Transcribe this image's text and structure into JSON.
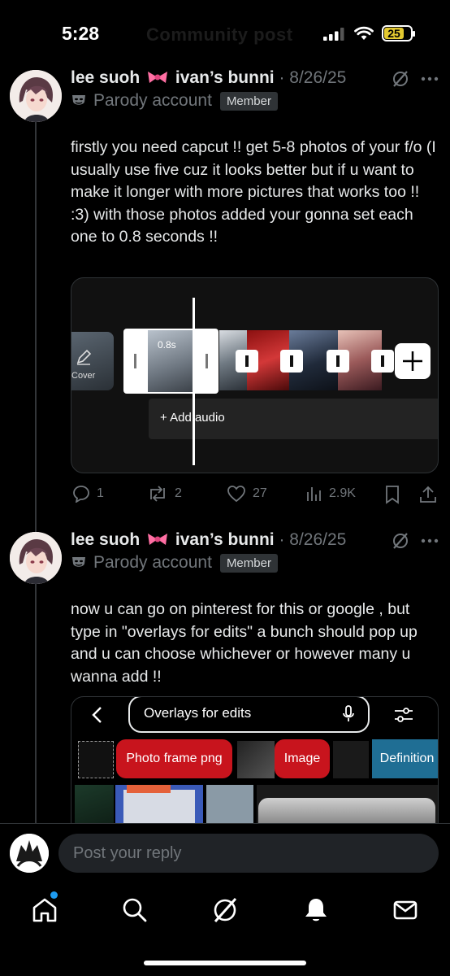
{
  "status_bar": {
    "time": "5:28",
    "battery": "25",
    "ghost_title": "Community post"
  },
  "posts": [
    {
      "name": "lee suoh",
      "name_suffix": "ivan’s bunni",
      "date": "· 8/26/25",
      "account_type": "Parody account",
      "badge": "Member",
      "text": "firstly you need capcut !! get 5-8 photos of your f/o (I usually use five cuz it looks better but if u want to make it longer with more pictures that works too !! :3) with those photos added your gonna set each one to 0.8 seconds !!",
      "media": {
        "clip_duration": "0.8s",
        "cover_label": "Cover",
        "add_audio": "+ Add audio"
      },
      "stats": {
        "replies": "1",
        "reposts": "2",
        "likes": "27",
        "views": "2.9K"
      }
    },
    {
      "name": "lee suoh",
      "name_suffix": "ivan’s bunni",
      "date": "· 8/26/25",
      "account_type": "Parody account",
      "badge": "Member",
      "text": "now u can go on pinterest for this or google , but type in \"overlays for edits\" a bunch should pop up and u can choose whichever or however many u wanna add !!",
      "media": {
        "search_query": "Overlays for edits",
        "chips": [
          "Photo frame png",
          "Image",
          "Definition"
        ]
      }
    }
  ],
  "reply": {
    "placeholder": "Post your reply"
  },
  "tabs": [
    "Home",
    "Search",
    "Grok",
    "Notifications",
    "Messages"
  ],
  "colors": {
    "accent": "#1d9bf0",
    "chip_red": "#c8141d",
    "chip_blue": "#1f6e94",
    "battery": "#e3c930"
  }
}
